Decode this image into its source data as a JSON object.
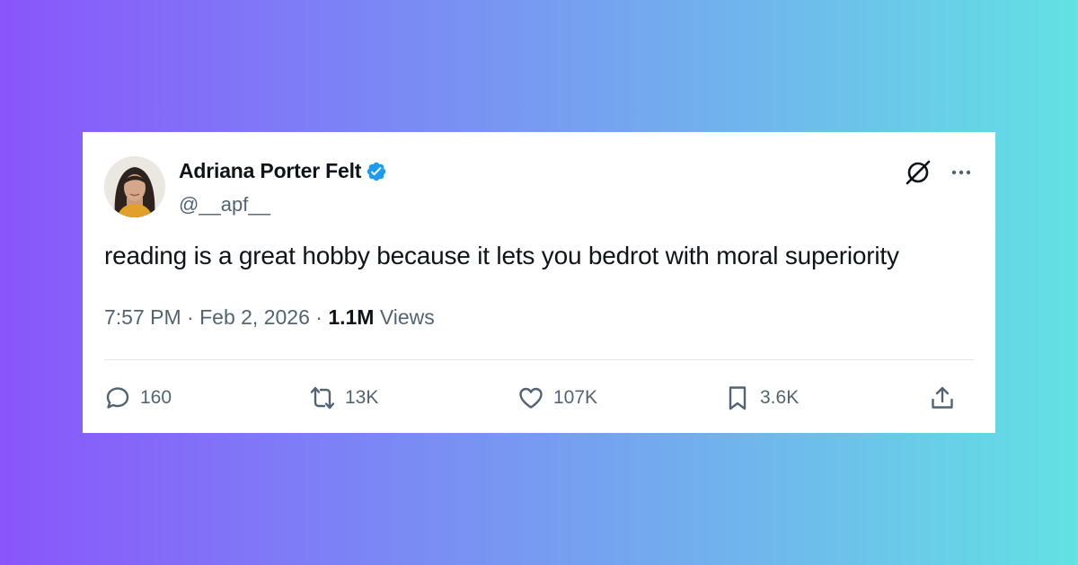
{
  "tweet": {
    "author": {
      "display_name": "Adriana Porter Felt",
      "handle": "@__apf__",
      "verified_icon": "verified-badge-icon"
    },
    "text": "reading is a great hobby because it lets you bedrot with moral superiority",
    "meta": {
      "time": "7:57 PM",
      "separator": "·",
      "date": "Feb 2, 2026",
      "views_count": "1.1M",
      "views_label": "Views"
    },
    "actions": {
      "replies": "160",
      "reposts": "13K",
      "likes": "107K",
      "bookmarks": "3.6K"
    }
  },
  "colors": {
    "verified_blue": "#1d9bf0",
    "text_primary": "#0f1419",
    "text_secondary": "#536471",
    "gradient_left": "#8a55fb",
    "gradient_right": "#62e2e3"
  },
  "icons": {
    "top_right": [
      "grok-icon",
      "more-options-icon"
    ],
    "actions": [
      "reply-icon",
      "repost-icon",
      "like-icon",
      "bookmark-icon",
      "share-icon"
    ]
  }
}
